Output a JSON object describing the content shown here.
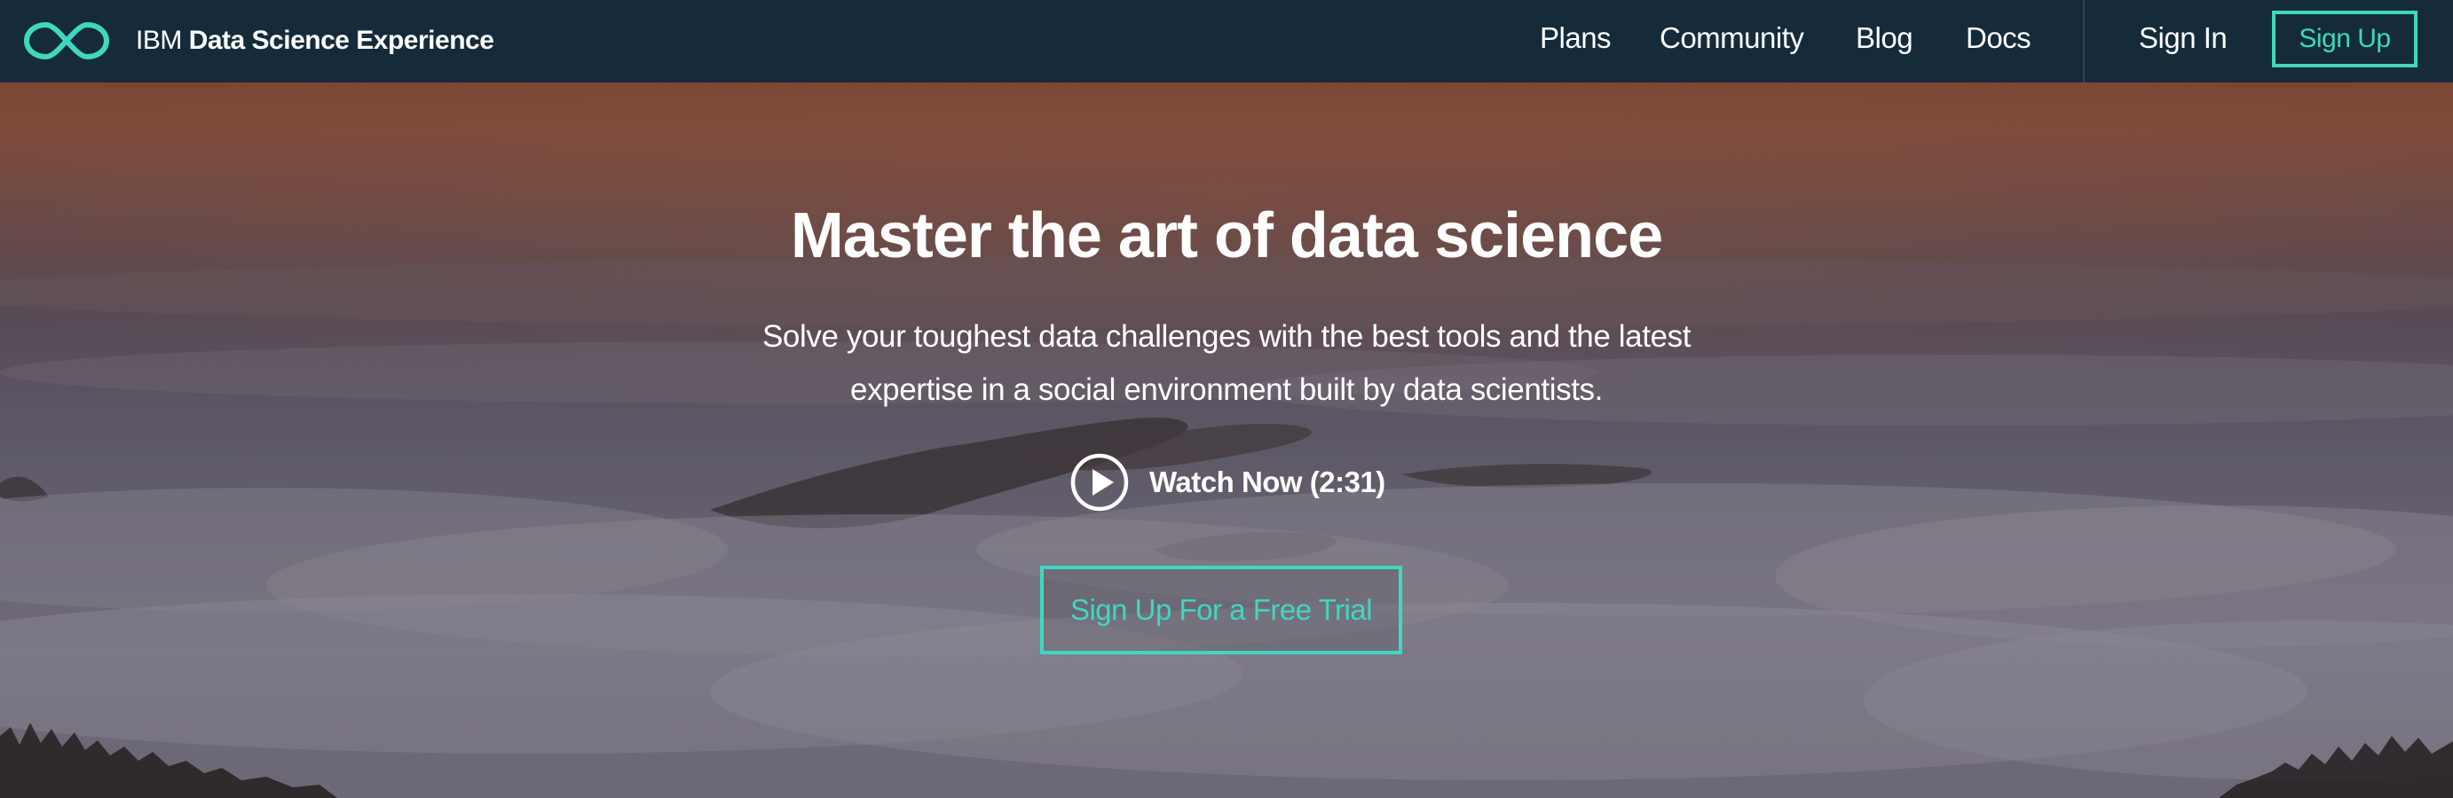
{
  "brand": {
    "prefix": "IBM",
    "name": "Data Science Experience",
    "logo_icon": "infinity-icon"
  },
  "nav": {
    "links": [
      {
        "label": "Plans"
      },
      {
        "label": "Community"
      },
      {
        "label": "Blog"
      },
      {
        "label": "Docs"
      }
    ],
    "sign_in": "Sign In",
    "sign_up": "Sign Up"
  },
  "hero": {
    "title": "Master the art of data science",
    "subtitle_line1": "Solve your toughest data challenges with the best tools and the latest",
    "subtitle_line2": "expertise in a social environment built by data scientists.",
    "watch_label": "Watch Now (2:31)",
    "watch_icon": "play-circle-icon",
    "cta_label": "Sign Up For a Free Trial",
    "background": "sunset-clouds-landscape"
  },
  "colors": {
    "navbar": "#152b3a",
    "accent": "#3ed8c0",
    "text": "#ffffff"
  }
}
